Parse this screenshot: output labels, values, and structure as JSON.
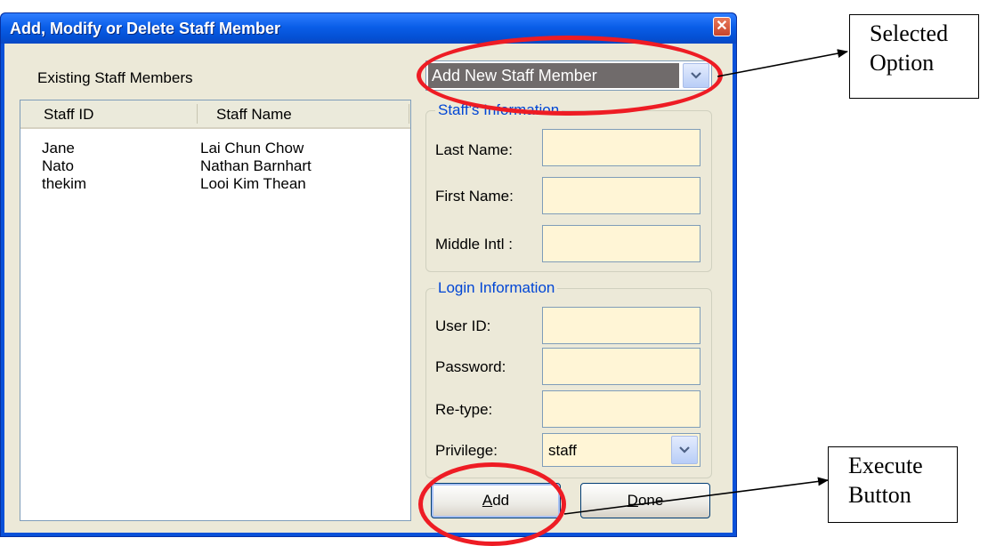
{
  "window": {
    "title": "Add, Modify or Delete Staff Member",
    "close_glyph": "✕"
  },
  "staff_list": {
    "label": "Existing Staff Members",
    "columns": [
      "Staff ID",
      "Staff Name"
    ],
    "rows": [
      {
        "id": "Jane",
        "name": "Lai Chun Chow"
      },
      {
        "id": "Nato",
        "name": "Nathan Barnhart"
      },
      {
        "id": "thekim",
        "name": "Looi Kim Thean"
      }
    ]
  },
  "mode_select": {
    "value": "Add New Staff Member",
    "icon": "chevron-down-icon"
  },
  "staff_info": {
    "title": "Staff's Information",
    "fields": [
      {
        "label": "Last Name:",
        "value": ""
      },
      {
        "label": "First Name:",
        "value": ""
      },
      {
        "label": "Middle Intl :",
        "value": ""
      }
    ]
  },
  "login_info": {
    "title": "Login Information",
    "fields": [
      {
        "label": "User ID:",
        "value": ""
      },
      {
        "label": "Password:",
        "value": ""
      },
      {
        "label": "Re-type:",
        "value": ""
      }
    ],
    "privilege": {
      "label": "Privilege:",
      "value": "staff"
    }
  },
  "buttons": {
    "add": {
      "mnemonic": "A",
      "rest": "dd"
    },
    "done": {
      "mnemonic": "D",
      "rest": "one"
    }
  },
  "annotations": {
    "selected_option": [
      "Selected",
      "Option"
    ],
    "execute_button": [
      "Execute",
      "Button"
    ],
    "highlight_color": "#ee1c24"
  },
  "colors": {
    "titlebar": "#0a5ee8",
    "dialog_bg": "#ece9d8",
    "field_bg": "#fff5d6",
    "group_title": "#0046d5",
    "selection": "#706b6b"
  }
}
